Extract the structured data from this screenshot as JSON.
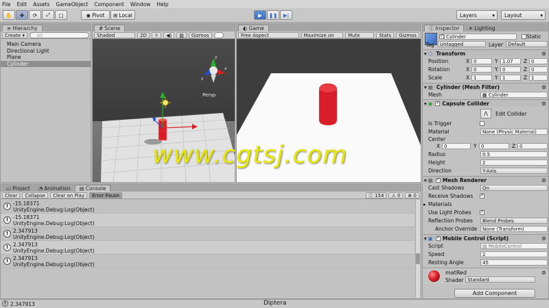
{
  "menu": [
    "File",
    "Edit",
    "Assets",
    "GameObject",
    "Component",
    "Window",
    "Help"
  ],
  "toolbar": {
    "pivot": "Pivot",
    "local": "Local",
    "layers": "Layers",
    "layout": "Layout"
  },
  "hierarchy": {
    "tab": "Hierarchy",
    "create": "Create",
    "search": "All",
    "items": [
      "Main Camera",
      "Directional Light",
      "Plane",
      "Cylinder"
    ],
    "selected": "Cylinder"
  },
  "scene": {
    "tab": "Scene",
    "shading": "Shaded",
    "mode2d": "2D",
    "gizmos": "Gizmos",
    "search": "All",
    "persp": "Persp",
    "axis_x": "x",
    "axis_y": "y",
    "axis_z": "z"
  },
  "game": {
    "tab": "Game",
    "aspect": "Free Aspect",
    "maximize": "Maximize on Play",
    "mute": "Mute audio",
    "stats": "Stats",
    "gizmos": "Gizmos"
  },
  "bottom": {
    "tabs": [
      "Project",
      "Animation",
      "Console"
    ],
    "active": "Console",
    "buttons": [
      "Clear",
      "Collapse",
      "Clear on Play",
      "Error Pause"
    ],
    "warn_count": "154",
    "err_count": "0",
    "info_count": "0"
  },
  "console": [
    {
      "value": "-15.18371",
      "source": "UnityEngine.Debug:Log(Object)"
    },
    {
      "value": "-15.18371",
      "source": "UnityEngine.Debug:Log(Object)"
    },
    {
      "value": "2.347913",
      "source": "UnityEngine.Debug:Log(Object)"
    },
    {
      "value": "2.347913",
      "source": "UnityEngine.Debug:Log(Object)"
    },
    {
      "value": "2.347913",
      "source": "UnityEngine.Debug:Log(Object)"
    }
  ],
  "status": {
    "text": "2.347913",
    "center": "Diptera"
  },
  "inspector": {
    "tabs": [
      "Inspector",
      "Lighting"
    ],
    "name": "Cylinder",
    "static": "Static",
    "tag_label": "Tag",
    "tag": "Untagged",
    "layer_label": "Layer",
    "layer": "Default",
    "transform": {
      "title": "Transform",
      "position": {
        "label": "Position",
        "x": "0",
        "y": "1.07",
        "z": "0"
      },
      "rotation": {
        "label": "Rotation",
        "x": "0",
        "y": "0",
        "z": "0"
      },
      "scale": {
        "label": "Scale",
        "x": "1",
        "y": "1",
        "z": "1"
      }
    },
    "meshfilter": {
      "title": "Cylinder (Mesh Filter)",
      "mesh_label": "Mesh",
      "mesh": "Cylinder"
    },
    "collider": {
      "title": "Capsule Collider",
      "edit": "Edit Collider",
      "is_trigger": "Is Trigger",
      "material_label": "Material",
      "material": "None (Physic Material)",
      "center": "Center",
      "cx": "0",
      "cy": "0",
      "cz": "0",
      "radius_label": "Radius",
      "radius": "0.5",
      "height_label": "Height",
      "height": "2",
      "direction_label": "Direction",
      "direction": "Y-Axis"
    },
    "renderer": {
      "title": "Mesh Renderer",
      "cast_label": "Cast Shadows",
      "cast": "On",
      "receive": "Receive Shadows",
      "materials": "Materials",
      "probes": "Use Light Probes",
      "reflection_label": "Reflection Probes",
      "reflection": "Blend Probes",
      "anchor_label": "Anchor Override",
      "anchor": "None (Transform)"
    },
    "script": {
      "title": "Mobile Control (Script)",
      "script_label": "Script",
      "script": "MobileControl",
      "speed_label": "Speed",
      "speed": "2",
      "angle_label": "Resting Angle",
      "angle": "45"
    },
    "material": {
      "name": "matRed",
      "shader_label": "Shader",
      "shader": "Standard"
    },
    "add_component": "Add Component"
  },
  "watermark": "www.cgtsj.com",
  "colors": {
    "red": "#d81e28",
    "play_blue": "#3b6fbf",
    "sky": "#3d3d3d"
  }
}
